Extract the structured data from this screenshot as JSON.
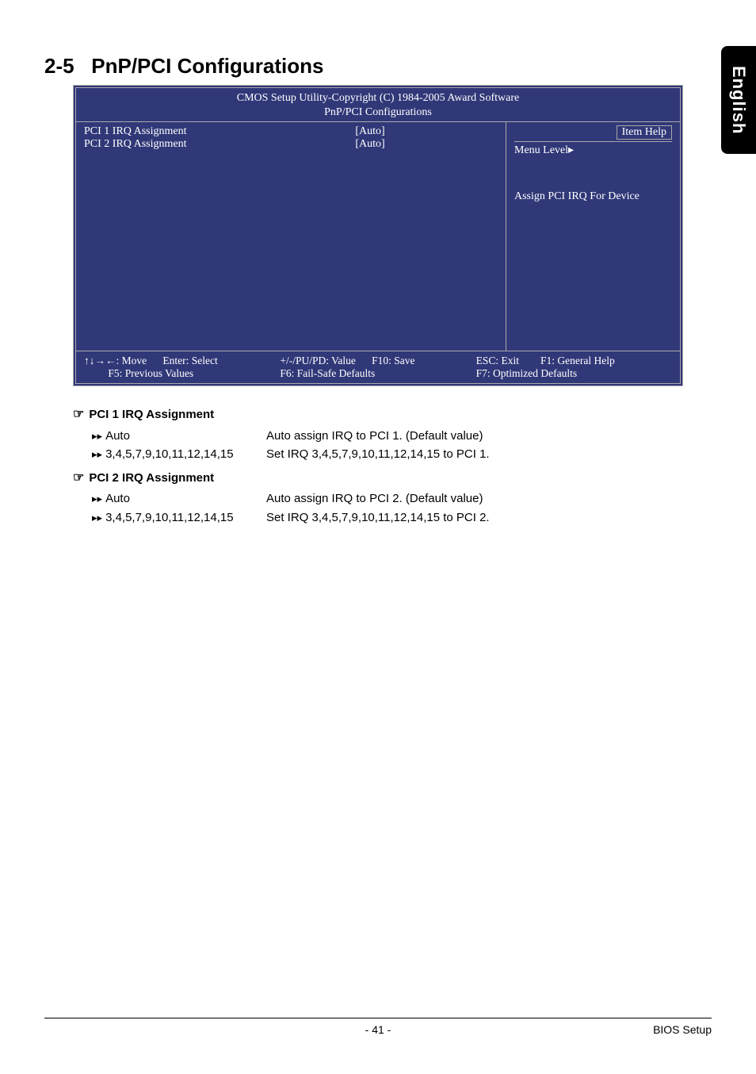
{
  "side_tab": "English",
  "section": {
    "num": "2-5",
    "title": "PnP/PCI Configurations"
  },
  "bios": {
    "copyright": "CMOS Setup Utility-Copyright (C) 1984-2005 Award Software",
    "subtitle": "PnP/PCI Configurations",
    "rows": [
      {
        "label": "PCI 1 IRQ Assignment",
        "value": "[Auto]"
      },
      {
        "label": "PCI 2 IRQ Assignment",
        "value": "[Auto]"
      }
    ],
    "help": {
      "title": "Item Help",
      "menu_level": "Menu Level",
      "body": "Assign PCI IRQ For Device"
    },
    "footer": {
      "move": "↑↓→←: Move",
      "enter": "Enter: Select",
      "value": "+/-/PU/PD: Value",
      "save": "F10: Save",
      "esc": "ESC: Exit",
      "f1": "F1: General Help",
      "f5": "F5: Previous Values",
      "f6": "F6: Fail-Safe Defaults",
      "f7": "F7: Optimized Defaults"
    }
  },
  "options": [
    {
      "header": "PCI 1 IRQ Assignment",
      "items": [
        {
          "label": "Auto",
          "desc": "Auto assign IRQ to PCI 1. (Default value)"
        },
        {
          "label": "3,4,5,7,9,10,11,12,14,15",
          "desc": "Set IRQ 3,4,5,7,9,10,11,12,14,15 to PCI 1."
        }
      ]
    },
    {
      "header": "PCI 2 IRQ Assignment",
      "items": [
        {
          "label": "Auto",
          "desc": "Auto assign IRQ to PCI 2. (Default value)"
        },
        {
          "label": "3,4,5,7,9,10,11,12,14,15",
          "desc": "Set IRQ 3,4,5,7,9,10,11,12,14,15 to PCI 2."
        }
      ]
    }
  ],
  "footer": {
    "page": "- 41 -",
    "section": "BIOS Setup"
  }
}
